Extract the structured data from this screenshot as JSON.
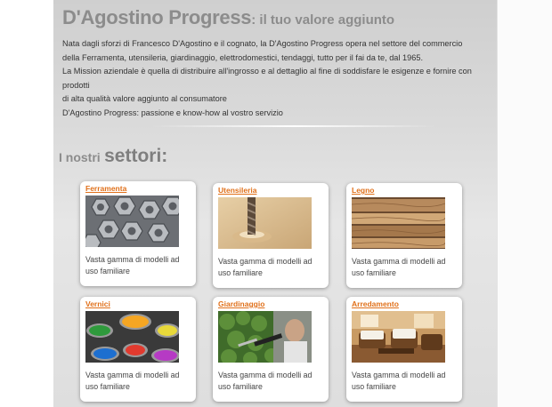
{
  "header": {
    "title": "D'Agostino Progress",
    "subtitle": ": il tuo valore aggiunto"
  },
  "intro": {
    "line1": "Nata dagli sforzi di Francesco D'Agostino e il cognato, la D'Agostino Progress opera nel settore del commercio",
    "line2": "della Ferramenta, utensileria, giardinaggio, elettrodomestici, tendaggi, tutto per il fai da te, dal 1965.",
    "line3": "La Mission aziendale è quella di distribuire all'ingrosso e al dettaglio al fine di soddisfare le esigenze e fornire con prodotti",
    "line4": "di alta qualità valore aggiunto al consumatore",
    "line5": "D'Agostino Progress: passione e know-how al vostro servizio"
  },
  "section": {
    "prefix": "I nostri",
    "title": "settori:"
  },
  "sectors": [
    {
      "name": "Ferramenta",
      "description": "Vasta gamma di modelli ad uso familiare",
      "icon": "hex-nuts-photo"
    },
    {
      "name": "Utensileria",
      "description": "Vasta gamma di modelli ad uso familiare",
      "icon": "drill-bit-photo"
    },
    {
      "name": "Legno",
      "description": "Vasta gamma di modelli ad uso familiare",
      "icon": "wood-planks-photo"
    },
    {
      "name": "Vernici",
      "description": "Vasta gamma di modelli ad uso familiare",
      "icon": "paint-cans-photo"
    },
    {
      "name": "Giardinaggio",
      "description": "Vasta gamma di modelli ad uso familiare",
      "icon": "hedge-trimmer-photo"
    },
    {
      "name": "Arredamento",
      "description": "Vasta gamma di modelli ad uso familiare",
      "icon": "furniture-photo"
    }
  ],
  "colors": {
    "accent": "#e0701a",
    "heading": "#8c8c8c",
    "body_text": "#333333"
  }
}
